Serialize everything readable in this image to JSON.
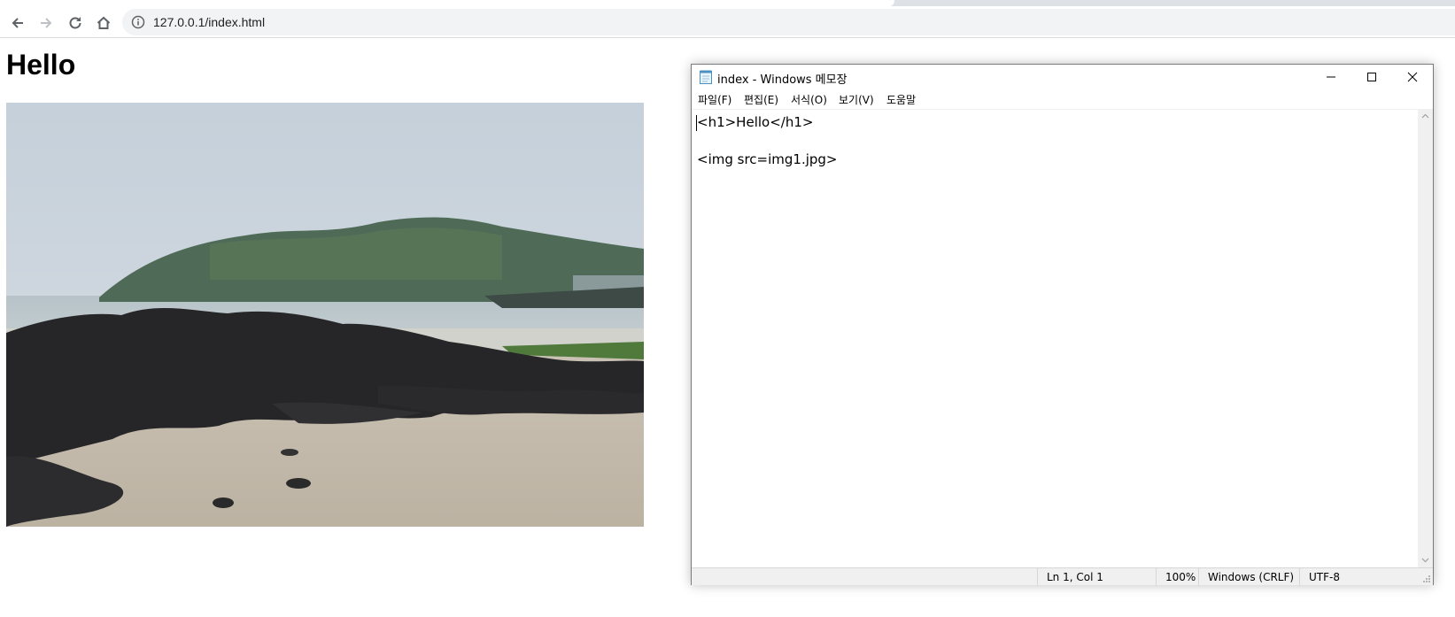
{
  "browser": {
    "url": "127.0.0.1/index.html"
  },
  "page": {
    "heading": "Hello"
  },
  "notepad": {
    "title": "index - Windows 메모장",
    "menu": [
      "파일(F)",
      "편집(E)",
      "서식(O)",
      "보기(V)",
      "도움말"
    ],
    "lines": [
      "<h1>Hello</h1>",
      "",
      "<img src=img1.jpg>"
    ],
    "status": {
      "position": "Ln 1, Col 1",
      "zoom": "100%",
      "line_endings": "Windows (CRLF)",
      "encoding": "UTF-8"
    }
  }
}
